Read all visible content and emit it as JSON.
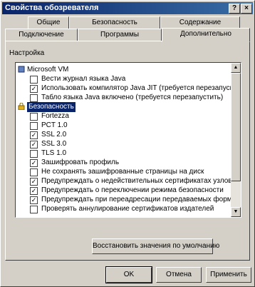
{
  "window": {
    "title": "Свойства обозревателя",
    "help_label": "?",
    "close_label": "×"
  },
  "tabs_row1": [
    "Общие",
    "Безопасность",
    "Содержание"
  ],
  "tabs_row2": [
    "Подключение",
    "Программы",
    "Дополнительно"
  ],
  "group_label": "Настройка",
  "items": [
    {
      "label": "Microsoft VM",
      "type": "group",
      "icon": "java-vm-icon"
    },
    {
      "label": "Вести журнал языка Java",
      "type": "checkbox",
      "checked": false
    },
    {
      "label": "Использовать компилятор Java JIT (требуется перезапуск)",
      "type": "checkbox",
      "checked": true
    },
    {
      "label": "Табло языка Java включено (требуется перезапустить)",
      "type": "checkbox",
      "checked": false
    },
    {
      "label": "Безопасность",
      "type": "group",
      "icon": "lock-icon",
      "selected": true
    },
    {
      "label": "Fortezza",
      "type": "checkbox",
      "checked": false
    },
    {
      "label": "PCT 1.0",
      "type": "checkbox",
      "checked": false
    },
    {
      "label": "SSL 2.0",
      "type": "checkbox",
      "checked": true
    },
    {
      "label": "SSL 3.0",
      "type": "checkbox",
      "checked": true
    },
    {
      "label": "TLS 1.0",
      "type": "checkbox",
      "checked": false
    },
    {
      "label": "Зашифровать профиль",
      "type": "checkbox",
      "checked": true
    },
    {
      "label": "Не сохранять зашифрованные страницы на диск",
      "type": "checkbox",
      "checked": false
    },
    {
      "label": "Предупреждать о недействительных сертификатах узлов",
      "type": "checkbox",
      "checked": true
    },
    {
      "label": "Предупреждать о переключении режима безопасности",
      "type": "checkbox",
      "checked": true
    },
    {
      "label": "Предупреждать при переадресации передаваемых форм",
      "type": "checkbox",
      "checked": true
    },
    {
      "label": "Проверять аннулирование сертификатов издателей",
      "type": "checkbox",
      "checked": false
    }
  ],
  "restore_button": "Восстановить значения по умолчанию",
  "buttons": {
    "ok": "OK",
    "cancel": "Отмена",
    "apply": "Применить"
  }
}
